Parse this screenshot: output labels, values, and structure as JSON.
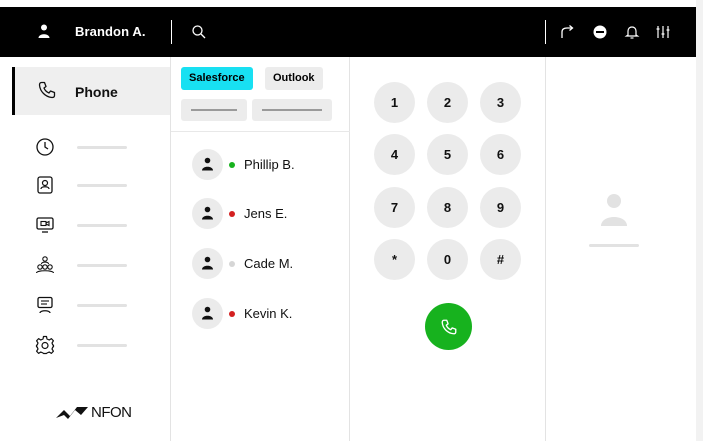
{
  "header": {
    "user_name": "Brandon A.",
    "icons": [
      "user-icon",
      "search-icon",
      "call-forward-icon",
      "do-not-disturb-icon",
      "bell-icon",
      "settings-sliders-icon"
    ]
  },
  "sidebar": {
    "active_item": {
      "label": "Phone",
      "icon": "phone-icon"
    },
    "items": [
      {
        "icon": "clock-icon"
      },
      {
        "icon": "contacts-book-icon"
      },
      {
        "icon": "screen-share-icon"
      },
      {
        "icon": "group-icon"
      },
      {
        "icon": "chat-icon"
      },
      {
        "icon": "gear-icon"
      }
    ],
    "logo_text": "NFON"
  },
  "contacts": {
    "tabs": [
      {
        "label": "Salesforce",
        "active": true
      },
      {
        "label": "Outlook",
        "active": false
      }
    ],
    "list": [
      {
        "name": "Phillip B.",
        "status_color": "#17b21e"
      },
      {
        "name": "Jens E.",
        "status_color": "#d42020"
      },
      {
        "name": "Cade M.",
        "status_color": "#d6d6d6"
      },
      {
        "name": "Kevin K.",
        "status_color": "#d42020"
      }
    ]
  },
  "dialpad": {
    "keys": [
      "1",
      "2",
      "3",
      "4",
      "5",
      "6",
      "7",
      "8",
      "9",
      "*",
      "0",
      "#"
    ],
    "call_icon": "phone-icon"
  },
  "colors": {
    "accent_tab": "#18e0f2",
    "call_green": "#17b21e",
    "topbar_bg": "#000000"
  }
}
